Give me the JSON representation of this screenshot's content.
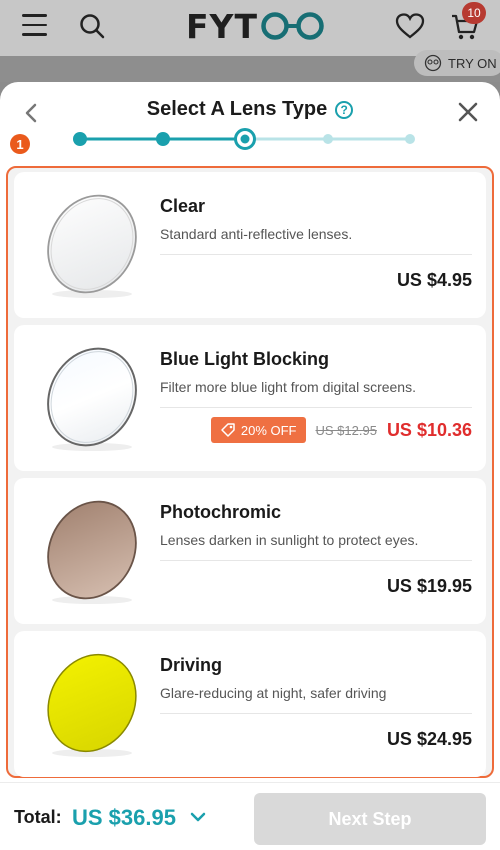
{
  "header": {
    "logo_text": "FYT",
    "cart_count": "10",
    "try_on_label": "TRY ON"
  },
  "sheet": {
    "title": "Select A Lens Type",
    "help_icon": "?",
    "step_marker": "1",
    "progress": {
      "total_steps": 5,
      "current_step": 3
    }
  },
  "options": [
    {
      "name": "Clear",
      "description": "Standard anti-reflective lenses.",
      "price": "US $4.95",
      "lens_color": "clear"
    },
    {
      "name": "Blue Light Blocking",
      "description": "Filter more blue light from digital screens.",
      "badge": "20% OFF",
      "old_price": "US $12.95",
      "price": "US $10.36",
      "lens_color": "blue-clear"
    },
    {
      "name": "Photochromic",
      "description": "Lenses darken in sunlight to protect eyes.",
      "price": "US $19.95",
      "lens_color": "#b89a89"
    },
    {
      "name": "Driving",
      "description": "Glare-reducing at night, safer driving",
      "price": "US $24.95",
      "lens_color": "#e6e400"
    }
  ],
  "footer": {
    "total_label": "Total:",
    "total_value": "US $36.95",
    "next_label": "Next Step"
  },
  "colors": {
    "accent": "#1aa0ad",
    "highlight": "#ee6b3a",
    "sale": "#e02d2d",
    "badge": "#ef7042"
  }
}
